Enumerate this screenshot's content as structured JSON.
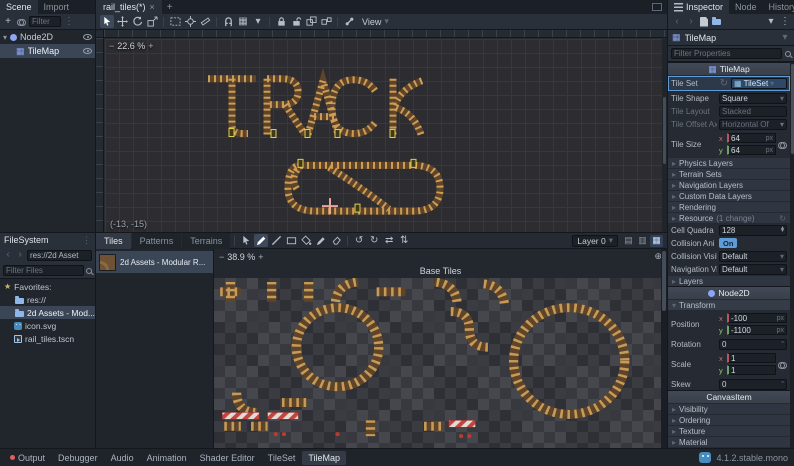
{
  "icons": {
    "chevron_down": "▾",
    "chevron_right": "▸",
    "chevron_up": "▴",
    "close": "×",
    "plus": "+",
    "minus": "−",
    "star": "★",
    "dots": "⋮",
    "back": "‹",
    "forward": "›",
    "reload": "↻",
    "rotate_left": "↺",
    "rotate_right": "↻",
    "flip_h": "⇄",
    "flip_v": "⇅",
    "target": "⊕",
    "grid": "▦",
    "list": "▤",
    "grid2": "▥"
  },
  "scene_panel": {
    "tabs": [
      {
        "label": "Scene"
      },
      {
        "label": "Import"
      }
    ],
    "filter_placeholder": "Filter",
    "tree": {
      "root": {
        "label": "Node2D"
      },
      "child": {
        "label": "TileMap"
      }
    }
  },
  "filesystem": {
    "title": "FileSystem",
    "path": "res://2d Asset",
    "filter_placeholder": "Filter Files",
    "favorites_label": "Favorites:",
    "items": [
      {
        "label": "res://"
      },
      {
        "label": "2d Assets - Mod..."
      },
      {
        "label": "icon.svg"
      },
      {
        "label": "rail_tiles.tscn"
      }
    ]
  },
  "scene_tabs": {
    "active_tab": "rail_tiles(*)"
  },
  "toolbar": {
    "view_menu": "View"
  },
  "viewport": {
    "zoom": "22.6 %",
    "coords": "(-13, -15)"
  },
  "tilemap_panel": {
    "tabs": [
      {
        "label": "Tiles"
      },
      {
        "label": "Patterns"
      },
      {
        "label": "Terrains"
      }
    ],
    "layer_select": "Layer 0",
    "source": {
      "label": "2d Assets - Modular R..."
    },
    "zoom": "38.9 %",
    "atlas_title": "Base Tiles"
  },
  "inspector": {
    "tabs": [
      {
        "label": "Inspector"
      },
      {
        "label": "Node"
      },
      {
        "label": "History"
      }
    ],
    "object_name": "TileMap",
    "filter_placeholder": "Filter Properties",
    "axis_x": "x",
    "axis_y": "y",
    "tilemap_section": {
      "title": "TileMap",
      "tile_set": {
        "label": "Tile Set",
        "value": "TileSet"
      },
      "tile_shape": {
        "label": "Tile Shape",
        "value": "Square"
      },
      "tile_layout": {
        "label": "Tile Layout",
        "value": "Stacked"
      },
      "tile_offset_axis": {
        "label": "Tile Offset Axis",
        "value": "Horizontal Of"
      },
      "tile_size": {
        "label": "Tile Size",
        "x": "64",
        "y": "64",
        "unit": "px"
      },
      "groups": [
        {
          "label": "Physics Layers"
        },
        {
          "label": "Terrain Sets"
        },
        {
          "label": "Navigation Layers"
        },
        {
          "label": "Custom Data Layers"
        },
        {
          "label": "Rendering"
        },
        {
          "label": "Resource",
          "suffix": "(1 change)"
        }
      ],
      "cell_quadrant": {
        "label": "Cell Quadra",
        "value": "128"
      },
      "collision_anim": {
        "label": "Collision Ani",
        "value": "On"
      },
      "collision_visibility": {
        "label": "Collision Visib",
        "value": "Default"
      },
      "navigation_visibility": {
        "label": "Navigation Visi",
        "value": "Default"
      },
      "layers_group": {
        "label": "Layers"
      }
    },
    "node2d_section": {
      "title": "Node2D",
      "transform_group": {
        "label": "Transform"
      },
      "position": {
        "label": "Position",
        "x": "-100",
        "y": "-1100",
        "unit": "px"
      },
      "rotation": {
        "label": "Rotation",
        "value": "0",
        "unit": "°"
      },
      "scale": {
        "label": "Scale",
        "x": "1",
        "y": "1"
      },
      "skew": {
        "label": "Skew",
        "value": "0",
        "unit": "°"
      }
    },
    "canvasitem_section": {
      "title": "CanvasItem",
      "groups": [
        {
          "label": "Visibility"
        },
        {
          "label": "Ordering"
        },
        {
          "label": "Texture"
        },
        {
          "label": "Material"
        }
      ]
    }
  },
  "status_bar": {
    "items": [
      {
        "label": "Output"
      },
      {
        "label": "Debugger"
      },
      {
        "label": "Audio"
      },
      {
        "label": "Animation"
      },
      {
        "label": "Shader Editor"
      },
      {
        "label": "TileSet"
      },
      {
        "label": "TileMap"
      }
    ],
    "version": "4.1.2.stable.mono"
  }
}
